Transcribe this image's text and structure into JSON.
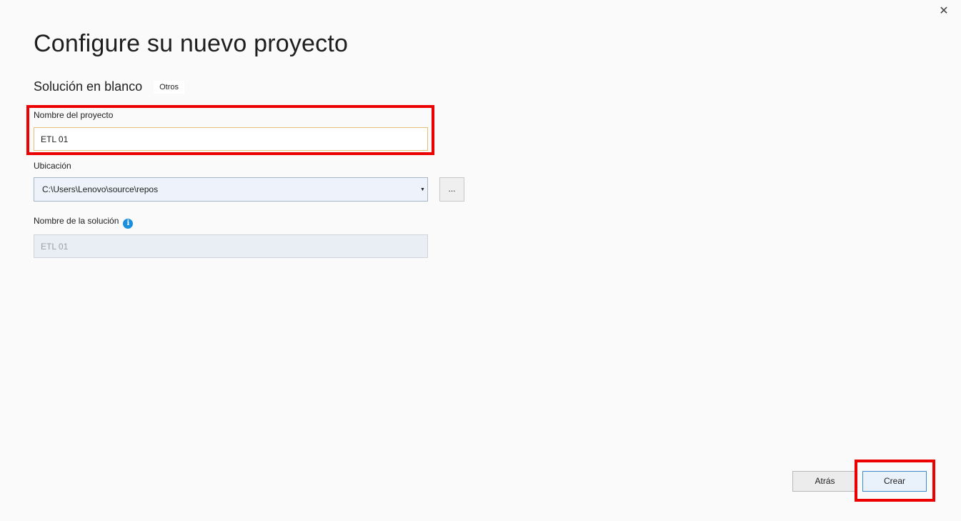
{
  "dialog": {
    "title": "Configure su nuevo proyecto",
    "close_glyph": "✕"
  },
  "template": {
    "name": "Solución en blanco",
    "tag": "Otros"
  },
  "project_name": {
    "label": "Nombre del proyecto",
    "value": "ETL 01"
  },
  "location": {
    "label": "Ubicación",
    "value": "C:\\Users\\Lenovo\\source\\repos",
    "browse_label": "..."
  },
  "solution_name": {
    "label": "Nombre de la solución",
    "value": "ETL 01",
    "info_glyph": "i"
  },
  "footer": {
    "back_label": "Atrás",
    "create_label": "Crear"
  },
  "colors": {
    "highlight": "#ec0000",
    "info": "#1c8ede",
    "create_border": "#3c8bd1"
  }
}
